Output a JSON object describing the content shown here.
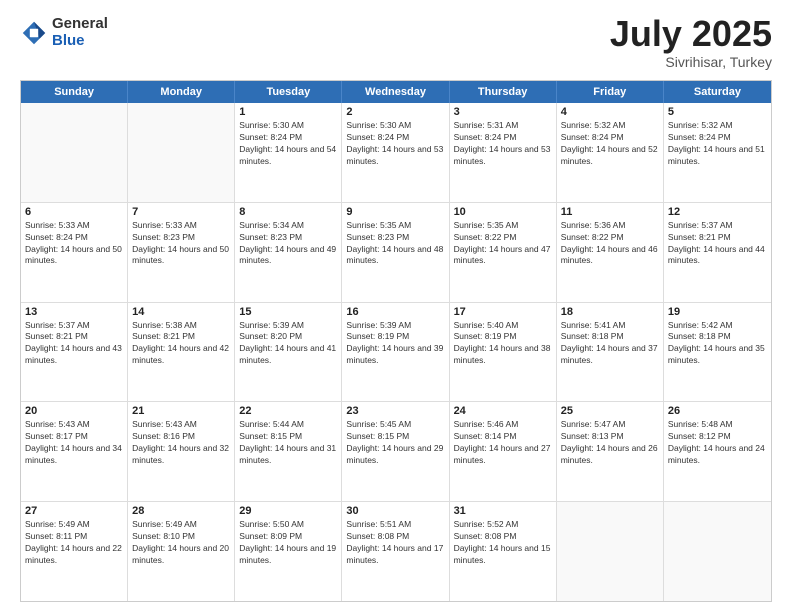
{
  "logo": {
    "general": "General",
    "blue": "Blue"
  },
  "title": "July 2025",
  "subtitle": "Sivrihisar, Turkey",
  "header_days": [
    "Sunday",
    "Monday",
    "Tuesday",
    "Wednesday",
    "Thursday",
    "Friday",
    "Saturday"
  ],
  "weeks": [
    [
      {
        "day": "",
        "sunrise": "",
        "sunset": "",
        "daylight": ""
      },
      {
        "day": "",
        "sunrise": "",
        "sunset": "",
        "daylight": ""
      },
      {
        "day": "1",
        "sunrise": "Sunrise: 5:30 AM",
        "sunset": "Sunset: 8:24 PM",
        "daylight": "Daylight: 14 hours and 54 minutes."
      },
      {
        "day": "2",
        "sunrise": "Sunrise: 5:30 AM",
        "sunset": "Sunset: 8:24 PM",
        "daylight": "Daylight: 14 hours and 53 minutes."
      },
      {
        "day": "3",
        "sunrise": "Sunrise: 5:31 AM",
        "sunset": "Sunset: 8:24 PM",
        "daylight": "Daylight: 14 hours and 53 minutes."
      },
      {
        "day": "4",
        "sunrise": "Sunrise: 5:32 AM",
        "sunset": "Sunset: 8:24 PM",
        "daylight": "Daylight: 14 hours and 52 minutes."
      },
      {
        "day": "5",
        "sunrise": "Sunrise: 5:32 AM",
        "sunset": "Sunset: 8:24 PM",
        "daylight": "Daylight: 14 hours and 51 minutes."
      }
    ],
    [
      {
        "day": "6",
        "sunrise": "Sunrise: 5:33 AM",
        "sunset": "Sunset: 8:24 PM",
        "daylight": "Daylight: 14 hours and 50 minutes."
      },
      {
        "day": "7",
        "sunrise": "Sunrise: 5:33 AM",
        "sunset": "Sunset: 8:23 PM",
        "daylight": "Daylight: 14 hours and 50 minutes."
      },
      {
        "day": "8",
        "sunrise": "Sunrise: 5:34 AM",
        "sunset": "Sunset: 8:23 PM",
        "daylight": "Daylight: 14 hours and 49 minutes."
      },
      {
        "day": "9",
        "sunrise": "Sunrise: 5:35 AM",
        "sunset": "Sunset: 8:23 PM",
        "daylight": "Daylight: 14 hours and 48 minutes."
      },
      {
        "day": "10",
        "sunrise": "Sunrise: 5:35 AM",
        "sunset": "Sunset: 8:22 PM",
        "daylight": "Daylight: 14 hours and 47 minutes."
      },
      {
        "day": "11",
        "sunrise": "Sunrise: 5:36 AM",
        "sunset": "Sunset: 8:22 PM",
        "daylight": "Daylight: 14 hours and 46 minutes."
      },
      {
        "day": "12",
        "sunrise": "Sunrise: 5:37 AM",
        "sunset": "Sunset: 8:21 PM",
        "daylight": "Daylight: 14 hours and 44 minutes."
      }
    ],
    [
      {
        "day": "13",
        "sunrise": "Sunrise: 5:37 AM",
        "sunset": "Sunset: 8:21 PM",
        "daylight": "Daylight: 14 hours and 43 minutes."
      },
      {
        "day": "14",
        "sunrise": "Sunrise: 5:38 AM",
        "sunset": "Sunset: 8:21 PM",
        "daylight": "Daylight: 14 hours and 42 minutes."
      },
      {
        "day": "15",
        "sunrise": "Sunrise: 5:39 AM",
        "sunset": "Sunset: 8:20 PM",
        "daylight": "Daylight: 14 hours and 41 minutes."
      },
      {
        "day": "16",
        "sunrise": "Sunrise: 5:39 AM",
        "sunset": "Sunset: 8:19 PM",
        "daylight": "Daylight: 14 hours and 39 minutes."
      },
      {
        "day": "17",
        "sunrise": "Sunrise: 5:40 AM",
        "sunset": "Sunset: 8:19 PM",
        "daylight": "Daylight: 14 hours and 38 minutes."
      },
      {
        "day": "18",
        "sunrise": "Sunrise: 5:41 AM",
        "sunset": "Sunset: 8:18 PM",
        "daylight": "Daylight: 14 hours and 37 minutes."
      },
      {
        "day": "19",
        "sunrise": "Sunrise: 5:42 AM",
        "sunset": "Sunset: 8:18 PM",
        "daylight": "Daylight: 14 hours and 35 minutes."
      }
    ],
    [
      {
        "day": "20",
        "sunrise": "Sunrise: 5:43 AM",
        "sunset": "Sunset: 8:17 PM",
        "daylight": "Daylight: 14 hours and 34 minutes."
      },
      {
        "day": "21",
        "sunrise": "Sunrise: 5:43 AM",
        "sunset": "Sunset: 8:16 PM",
        "daylight": "Daylight: 14 hours and 32 minutes."
      },
      {
        "day": "22",
        "sunrise": "Sunrise: 5:44 AM",
        "sunset": "Sunset: 8:15 PM",
        "daylight": "Daylight: 14 hours and 31 minutes."
      },
      {
        "day": "23",
        "sunrise": "Sunrise: 5:45 AM",
        "sunset": "Sunset: 8:15 PM",
        "daylight": "Daylight: 14 hours and 29 minutes."
      },
      {
        "day": "24",
        "sunrise": "Sunrise: 5:46 AM",
        "sunset": "Sunset: 8:14 PM",
        "daylight": "Daylight: 14 hours and 27 minutes."
      },
      {
        "day": "25",
        "sunrise": "Sunrise: 5:47 AM",
        "sunset": "Sunset: 8:13 PM",
        "daylight": "Daylight: 14 hours and 26 minutes."
      },
      {
        "day": "26",
        "sunrise": "Sunrise: 5:48 AM",
        "sunset": "Sunset: 8:12 PM",
        "daylight": "Daylight: 14 hours and 24 minutes."
      }
    ],
    [
      {
        "day": "27",
        "sunrise": "Sunrise: 5:49 AM",
        "sunset": "Sunset: 8:11 PM",
        "daylight": "Daylight: 14 hours and 22 minutes."
      },
      {
        "day": "28",
        "sunrise": "Sunrise: 5:49 AM",
        "sunset": "Sunset: 8:10 PM",
        "daylight": "Daylight: 14 hours and 20 minutes."
      },
      {
        "day": "29",
        "sunrise": "Sunrise: 5:50 AM",
        "sunset": "Sunset: 8:09 PM",
        "daylight": "Daylight: 14 hours and 19 minutes."
      },
      {
        "day": "30",
        "sunrise": "Sunrise: 5:51 AM",
        "sunset": "Sunset: 8:08 PM",
        "daylight": "Daylight: 14 hours and 17 minutes."
      },
      {
        "day": "31",
        "sunrise": "Sunrise: 5:52 AM",
        "sunset": "Sunset: 8:08 PM",
        "daylight": "Daylight: 14 hours and 15 minutes."
      },
      {
        "day": "",
        "sunrise": "",
        "sunset": "",
        "daylight": ""
      },
      {
        "day": "",
        "sunrise": "",
        "sunset": "",
        "daylight": ""
      }
    ]
  ]
}
